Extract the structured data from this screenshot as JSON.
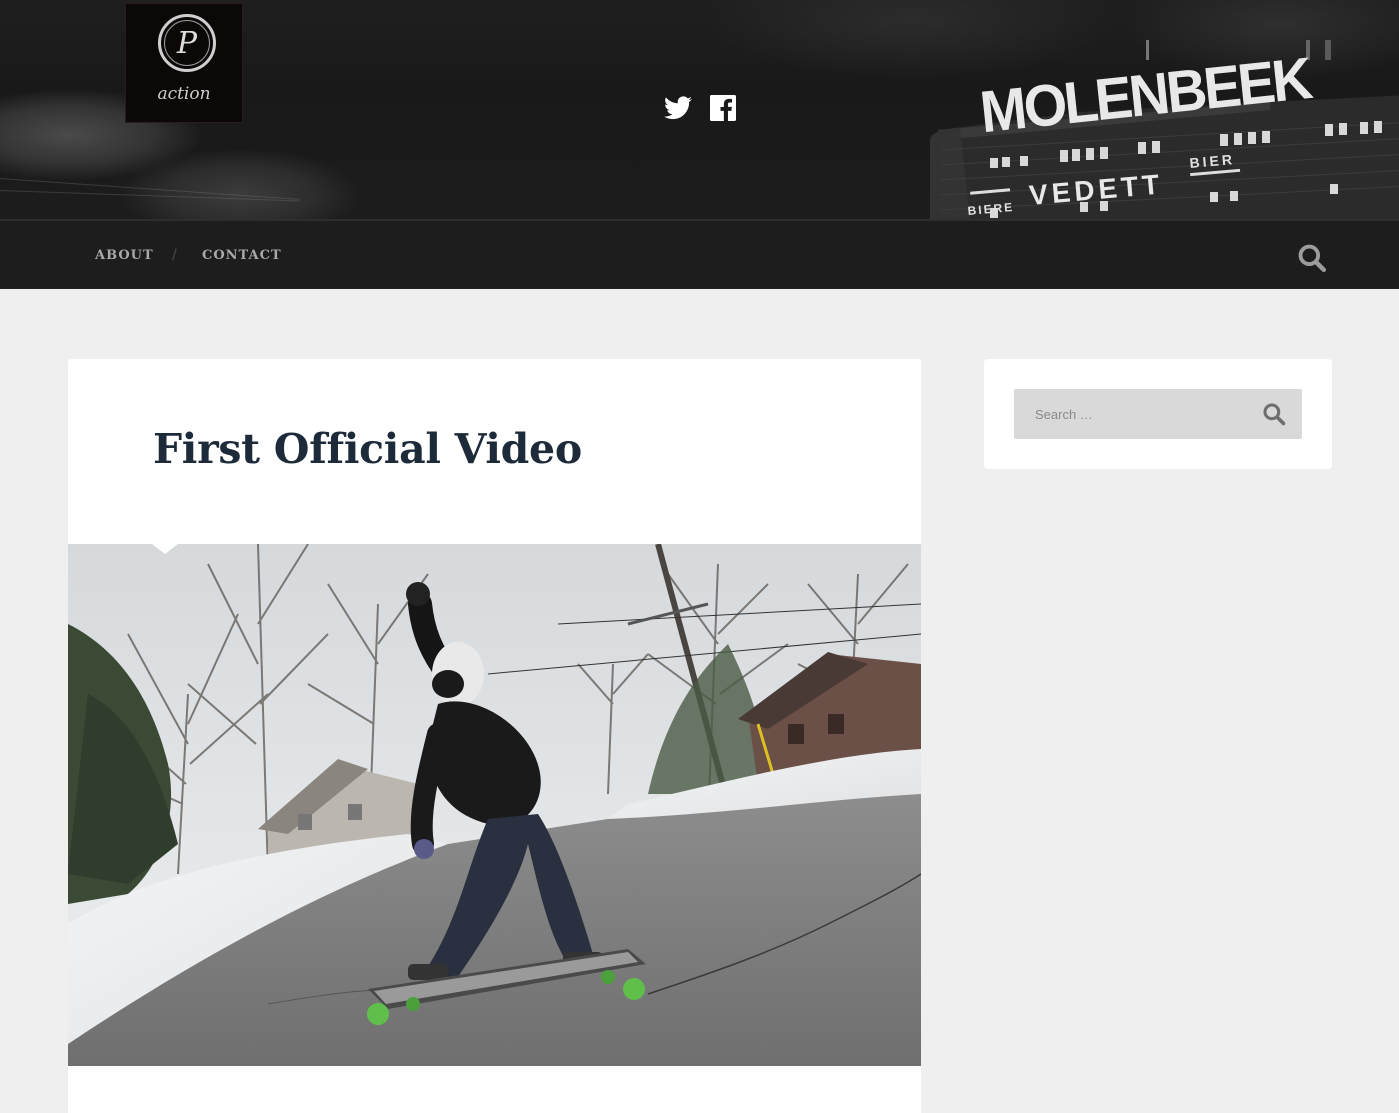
{
  "site": {
    "logo_text": "action",
    "logo_monogram": "P",
    "banner_sign": "MOLENBEEK",
    "banner_signs": [
      "VEDETT",
      "BIERE",
      "BIER"
    ]
  },
  "social": [
    {
      "name": "twitter-icon"
    },
    {
      "name": "facebook-icon"
    }
  ],
  "nav": {
    "items": [
      {
        "label": "ABOUT"
      },
      {
        "label": "CONTACT"
      }
    ],
    "separator": "/"
  },
  "post": {
    "title": "First Official Video"
  },
  "sidebar": {
    "search": {
      "placeholder": "Search …"
    }
  },
  "colors": {
    "accent": "#1d2a3a",
    "nav_bg": "#1d1d1d",
    "page_bg": "#efefef"
  }
}
